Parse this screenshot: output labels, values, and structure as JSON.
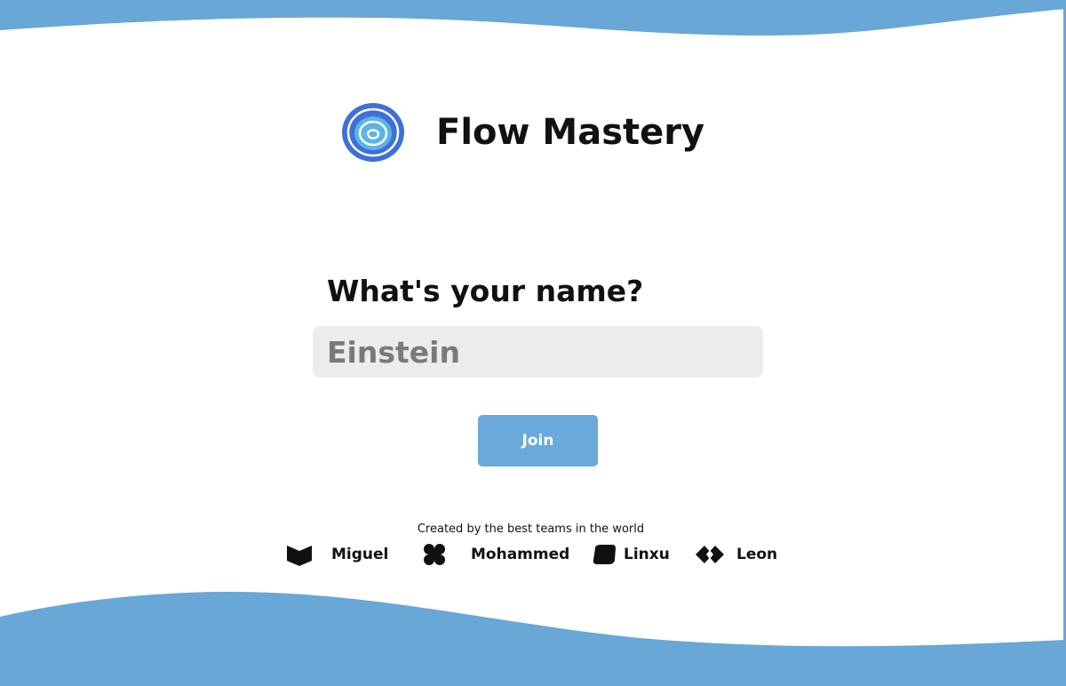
{
  "app": {
    "title": "Flow Mastery",
    "logo_icon": "spiral-logo-icon"
  },
  "form": {
    "question": "What's your name?",
    "name_value": "Einstein",
    "join_label": "Join"
  },
  "credits": {
    "tagline": "Created by the best teams in the world",
    "teams": [
      {
        "name": "Miguel",
        "icon": "bookmark-shape-icon"
      },
      {
        "name": "Mohammed",
        "icon": "clover-shape-icon"
      },
      {
        "name": "Linxu",
        "icon": "rounded-square-icon"
      },
      {
        "name": "Leon",
        "icon": "diamond-pair-icon"
      }
    ]
  },
  "colors": {
    "wave": "#68a7d6",
    "accent_button": "#6aa9da",
    "logo_outer": "#3f6fd8",
    "logo_inner": "#5bb4e6",
    "input_bg": "#ececec",
    "text": "#111111"
  }
}
